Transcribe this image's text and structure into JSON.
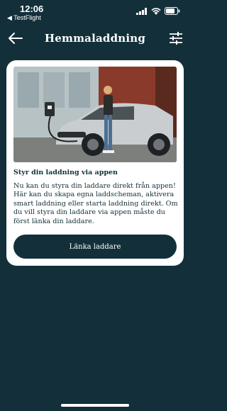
{
  "status": {
    "time": "12:06",
    "back_app": "◀ TestFlight"
  },
  "header": {
    "title": "Hemmaladdning"
  },
  "card": {
    "title": "Styr din laddning via appen",
    "text": "Nu kan du styra din laddare direkt från appen! Här kan du skapa egna laddscheman, aktivera smart laddning eller starta laddning direkt. Om du vill styra din laddare via appen måste du först länka din laddare.",
    "button_label": "Länka laddare"
  },
  "colors": {
    "background": "#13303a",
    "card": "#ffffff",
    "button": "#13303a"
  }
}
